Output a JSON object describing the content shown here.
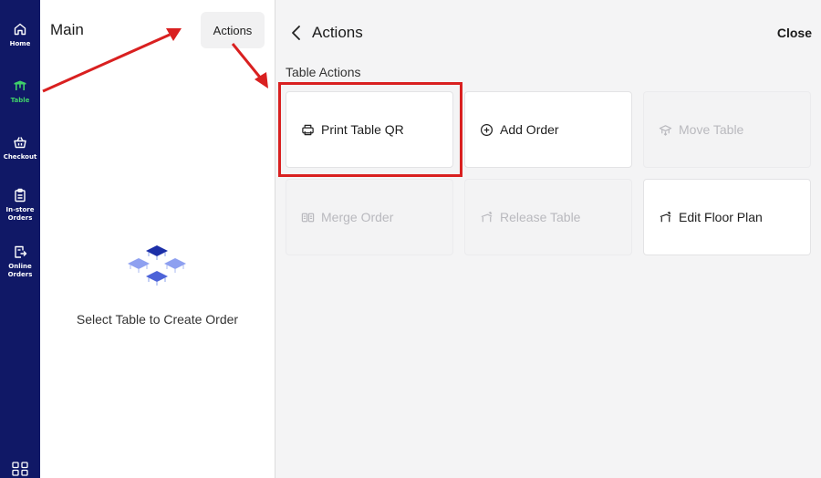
{
  "nav": {
    "items": [
      {
        "label": "Home",
        "icon": "home-icon"
      },
      {
        "label": "Table",
        "icon": "table-icon",
        "active": true
      },
      {
        "label": "Checkout",
        "icon": "basket-icon"
      },
      {
        "label": "In-store\nOrders",
        "icon": "clipboard-icon"
      },
      {
        "label": "Online\nOrders",
        "icon": "online-order-icon"
      }
    ],
    "bottom_icon": "grid-menu-icon"
  },
  "main": {
    "title": "Main",
    "actions_label": "Actions",
    "empty_text": "Select Table to Create Order"
  },
  "sheet": {
    "title": "Actions",
    "close_label": "Close",
    "section_label": "Table Actions",
    "actions": [
      {
        "label": "Print Table QR",
        "icon": "printer-icon",
        "enabled": true,
        "highlighted": true
      },
      {
        "label": "Add Order",
        "icon": "plus-circle-icon",
        "enabled": true
      },
      {
        "label": "Move Table",
        "icon": "move-table-icon",
        "enabled": false
      },
      {
        "label": "Merge Order",
        "icon": "merge-icon",
        "enabled": false
      },
      {
        "label": "Release Table",
        "icon": "release-table-icon",
        "enabled": false
      },
      {
        "label": "Edit Floor Plan",
        "icon": "floor-plan-icon",
        "enabled": true
      }
    ]
  },
  "colors": {
    "rail": "#101866",
    "active_nav": "#3fd06a",
    "annotation": "#d92020",
    "sheet_bg": "#f4f4f5",
    "table_illustration": "#1c2fa8"
  }
}
